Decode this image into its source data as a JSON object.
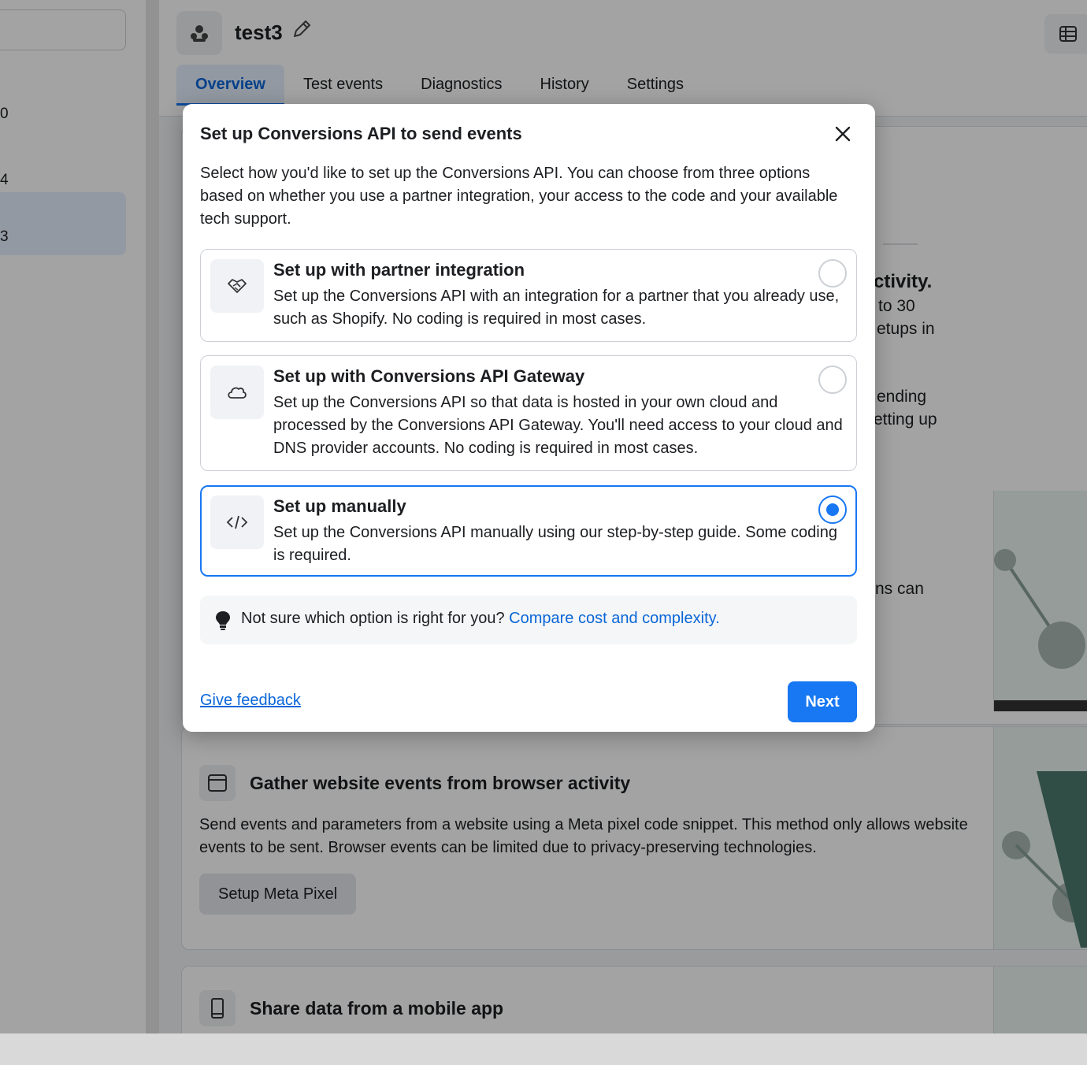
{
  "left_rail": {
    "rows": [
      "0",
      "4",
      "3"
    ]
  },
  "header": {
    "dataset_name": "test3",
    "tabs": [
      "Overview",
      "Test events",
      "Diagnostics",
      "History",
      "Settings"
    ],
    "active_tab": "Overview"
  },
  "background": {
    "fragments": {
      "f1": "ctivity.",
      "f2": "to 30",
      "f3": "etups in",
      "f4": "ending",
      "f5": "etting up",
      "f6": "ns can"
    },
    "browser_card": {
      "title": "Gather website events from browser activity",
      "description": "Send events and parameters from a website using a Meta pixel code snippet. This method only allows website events to be sent. Browser events can be limited due to privacy-preserving technologies.",
      "button_label": "Setup Meta Pixel"
    },
    "mobile_card": {
      "title": "Share data from a mobile app"
    }
  },
  "modal": {
    "title": "Set up Conversions API to send events",
    "intro": "Select how you'd like to set up the Conversions API. You can choose from three options based on whether you use a partner integration, your access to the code and your available tech support.",
    "options": [
      {
        "icon": "handshake-icon",
        "title": "Set up with partner integration",
        "description": "Set up the Conversions API with an integration for a partner that you already use, such as Shopify. No coding is required in most cases.",
        "selected": false
      },
      {
        "icon": "cloud-icon",
        "title": "Set up with Conversions API Gateway",
        "description": "Set up the Conversions API so that data is hosted in your own cloud and processed by the Conversions API Gateway. You'll need access to your cloud and DNS provider accounts. No coding is required in most cases.",
        "selected": false
      },
      {
        "icon": "code-icon",
        "title": "Set up manually",
        "description": "Set up the Conversions API manually using our step-by-step guide. Some coding is required.",
        "selected": true
      }
    ],
    "tip": {
      "text": "Not sure which option is right for you?",
      "link": "Compare cost and complexity."
    },
    "feedback_label": "Give feedback",
    "next_label": "Next"
  },
  "colors": {
    "accent": "#1877f2",
    "link": "#0a66d8",
    "overlay": "rgba(0,0,0,0.36)"
  }
}
